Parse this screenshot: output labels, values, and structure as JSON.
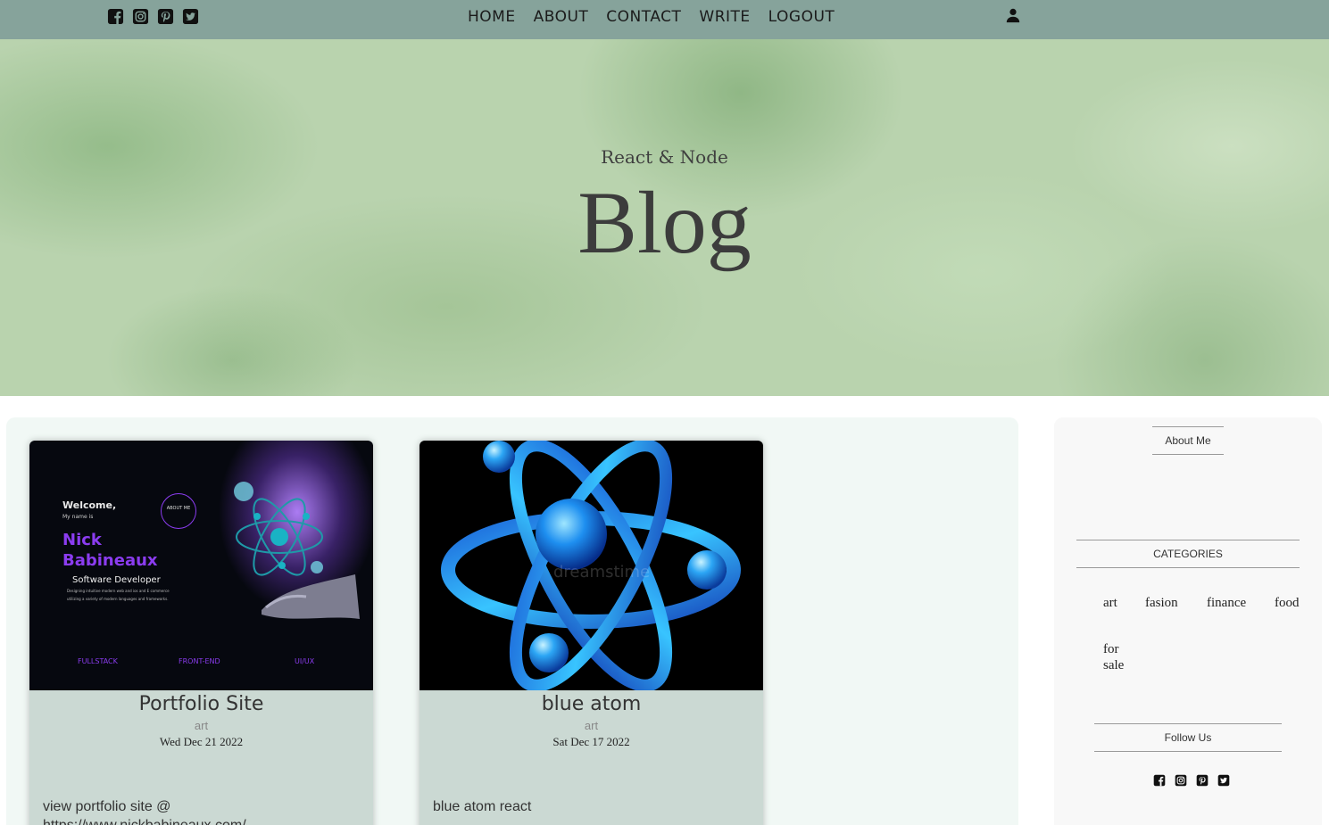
{
  "topbar": {
    "social_icons": [
      "facebook-icon",
      "instagram-icon",
      "pinterest-icon",
      "twitter-icon"
    ],
    "nav": [
      "HOME",
      "ABOUT",
      "CONTACT",
      "WRITE",
      "LOGOUT"
    ],
    "user_icon": "user-icon"
  },
  "hero": {
    "subtitle": "React & Node",
    "title": "Blog"
  },
  "posts": [
    {
      "title": "Portfolio Site",
      "category": "art",
      "date": "Wed Dec 21 2022",
      "desc": "view portfolio site @ https://www.nickbabineaux.com/",
      "image": {
        "welcome": "Welcome,",
        "my_name_is": "My name is",
        "name_line1": "Nick",
        "name_line2": "Babineaux",
        "role": "Software Developer",
        "blurb_line1": "Designing intuitive modern web and ios and E commerce",
        "blurb_line2": "utilizing a variety of modern languages and frameworks.",
        "about_btn": "ABOUT ME",
        "tags": [
          "FULLSTACK",
          "FRONT-END",
          "UI/UX"
        ]
      }
    },
    {
      "title": "blue atom",
      "category": "art",
      "date": "Sat Dec 17 2022",
      "desc": "blue atom react",
      "image": {
        "watermark": "dreamstime"
      }
    }
  ],
  "sidebar": {
    "about_title": "About Me",
    "categories_title": "CATEGORIES",
    "categories": [
      "art",
      "fasion",
      "finance",
      "food",
      "for sale"
    ],
    "follow_title": "Follow Us",
    "social_icons": [
      "facebook-icon",
      "instagram-icon",
      "pinterest-icon",
      "twitter-icon"
    ]
  },
  "colors": {
    "topbar": "#86a39b",
    "hero": "#b9d3ae",
    "posts_bg": "#f1f8f5",
    "card_bg": "#cbd9d3",
    "sidebar_bg": "#f8f8f8"
  }
}
